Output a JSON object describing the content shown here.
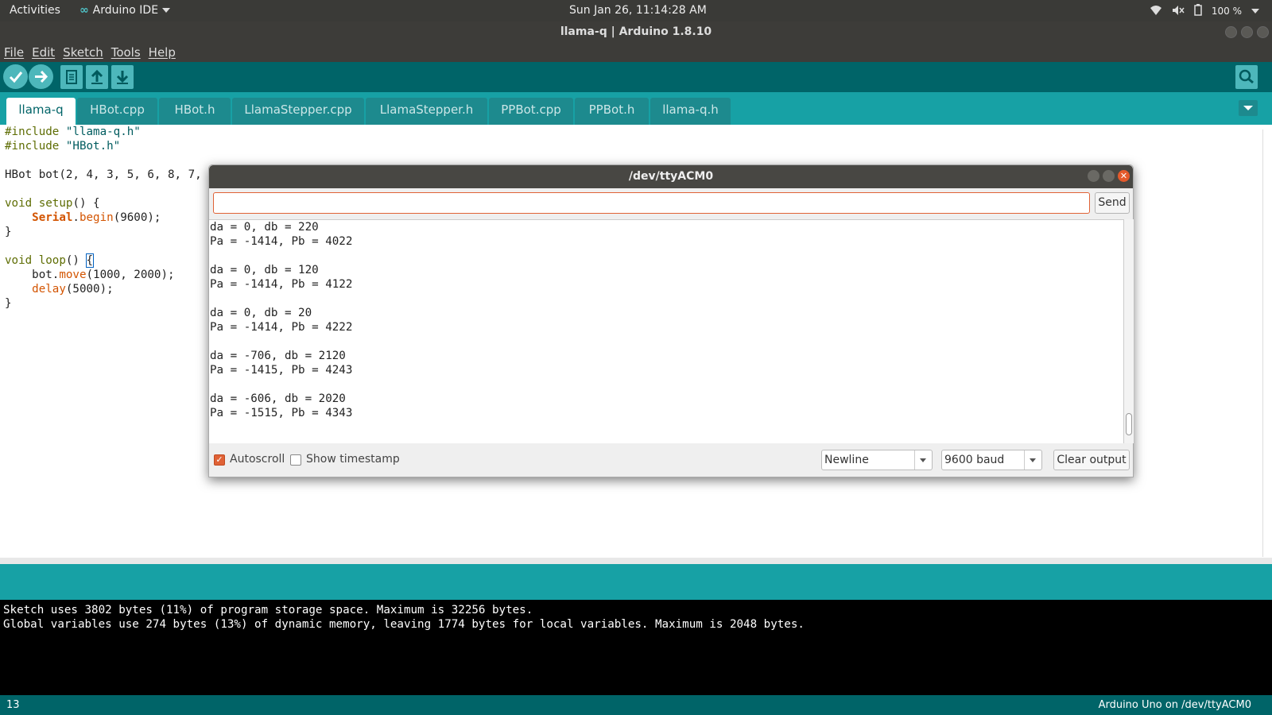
{
  "topbar": {
    "activities": "Activities",
    "app_name": "Arduino IDE",
    "clock": "Sun Jan 26, 11:14:28 AM",
    "battery": "100 %"
  },
  "window": {
    "title": "llama-q | Arduino 1.8.10"
  },
  "menu": {
    "file": "File",
    "edit": "Edit",
    "sketch": "Sketch",
    "tools": "Tools",
    "help": "Help"
  },
  "tabs": [
    {
      "label": "llama-q"
    },
    {
      "label": "HBot.cpp"
    },
    {
      "label": "HBot.h"
    },
    {
      "label": "LlamaStepper.cpp"
    },
    {
      "label": "LlamaStepper.h"
    },
    {
      "label": "PPBot.cpp"
    },
    {
      "label": "PPBot.h"
    },
    {
      "label": "llama-q.h"
    }
  ],
  "code": {
    "l1_kw": "#include",
    "l1_str": "\"llama-q.h\"",
    "l2_kw": "#include",
    "l2_str": "\"HBot.h\"",
    "l4": "HBot bot(2, 4, 3, 5, 6, 8, 7,",
    "l6_kw": "void",
    "l6_fn": "setup",
    "l6_rest": "() {",
    "l7_obj": "Serial",
    "l7_fn": "begin",
    "l7_rest": "(9600);",
    "l8": "}",
    "l10_kw": "void",
    "l10_fn": "loop",
    "l10_rest": "() ",
    "l10_brace": "{",
    "l11_obj": "bot.",
    "l11_fn": "move",
    "l11_rest": "(1000, 2000);",
    "l12_fn": "delay",
    "l12_rest": "(5000);",
    "l13": "}"
  },
  "serial_monitor": {
    "title": "/dev/ttyACM0",
    "input_value": "",
    "send_label": "Send",
    "output": [
      "da = 0, db = 220",
      "Pa = -1414, Pb = 4022",
      "",
      "da = 0, db = 120",
      "Pa = -1414, Pb = 4122",
      "",
      "da = 0, db = 20",
      "Pa = -1414, Pb = 4222",
      "",
      "da = -706, db = 2120",
      "Pa = -1415, Pb = 4243",
      "",
      "da = -606, db = 2020",
      "Pa = -1515, Pb = 4343"
    ],
    "autoscroll_label": "Autoscroll",
    "autoscroll_checked": true,
    "timestamp_label": "Show timestamp",
    "timestamp_checked": false,
    "line_ending": "Newline",
    "baud": "9600 baud",
    "clear_label": "Clear output"
  },
  "console": {
    "lines": [
      "Sketch uses 3802 bytes (11%) of program storage space. Maximum is 32256 bytes.",
      "Global variables use 274 bytes (13%) of dynamic memory, leaving 1774 bytes for local variables. Maximum is 2048 bytes."
    ]
  },
  "footer": {
    "line_number": "13",
    "board": "Arduino Uno on /dev/ttyACM0"
  },
  "colors": {
    "teal_dark": "#006468",
    "teal": "#17a1a5",
    "accent_orange": "#e06236"
  }
}
